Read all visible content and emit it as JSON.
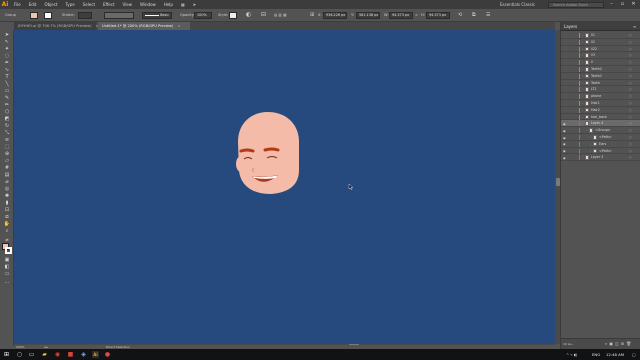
{
  "app": {
    "logo": "Ai",
    "menu": [
      "File",
      "Edit",
      "Object",
      "Type",
      "Select",
      "Effect",
      "View",
      "Window",
      "Help"
    ],
    "workspace": "Essentials Classic",
    "search_placeholder": "Search Adobe Stock"
  },
  "control_bar": {
    "selection_label": "Group",
    "stroke_label": "Stroke:",
    "brush_label": "Basic",
    "opacity_label": "Opacity:",
    "opacity_value": "100%",
    "style_label": "Style:",
    "x_label": "X:",
    "x_value": "936.226 px",
    "y_label": "Y:",
    "y_value": "581.138 px",
    "w_label": "W:",
    "w_value": "94.373 px",
    "h_label": "H:",
    "h_value": "94.373 px",
    "fill_color": "#f1c2b2",
    "stroke_color": "#ffffff"
  },
  "tabs": [
    {
      "label": "JOYHHO.ai @ 706.7% (RGB/GPU Preview)",
      "active": false
    },
    {
      "label": "Untitled-1* @ 200% (RGB/GPU Preview)",
      "active": true
    }
  ],
  "canvas": {
    "background": "#264a7e",
    "skin": "#f4bba8",
    "skin_shadow": "#e5a191",
    "brow": "#b23a14",
    "mouth": "#a63a1f"
  },
  "status": {
    "zoom": "200%",
    "tool": "Direct Selection"
  },
  "layers": {
    "title": "Layers",
    "rows": [
      {
        "name": "ll1",
        "color": "#4fbf3a"
      },
      {
        "name": "ll2",
        "color": "#4fbf3a"
      },
      {
        "name": "ll22",
        "color": "#4fbf3a"
      },
      {
        "name": "ll3",
        "color": "#4fbf3a"
      },
      {
        "name": "ll",
        "color": "#4fbf3a"
      },
      {
        "name": "Teeth2",
        "color": "#4fbf3a"
      },
      {
        "name": "Teeth1",
        "color": "#4fbf3a"
      },
      {
        "name": "Teeth",
        "color": "#4fbf3a"
      },
      {
        "name": "LT1",
        "color": "#4fbf3a"
      },
      {
        "name": "phone",
        "color": "#4fbf3a"
      },
      {
        "name": "Hair1",
        "color": "#4fbf3a"
      },
      {
        "name": "Hair2",
        "color": "#4fbf3a"
      },
      {
        "name": "hair_back",
        "color": "#4fbf3a"
      },
      {
        "name": "Layer 4",
        "color": "#4a7cff",
        "selected": true
      },
      {
        "name": "<Group>",
        "color": "#4a7cff"
      },
      {
        "name": "<Path>",
        "color": "#4a7cff"
      },
      {
        "name": "Ears",
        "color": "#4a7cff"
      },
      {
        "name": "<Path>",
        "color": "#4a7cff"
      },
      {
        "name": "Layer 3",
        "color": "#4a7cff"
      }
    ],
    "footer_count": "19 La..."
  },
  "taskbar": {
    "lang": "ENG",
    "time": "12:48 AM"
  }
}
